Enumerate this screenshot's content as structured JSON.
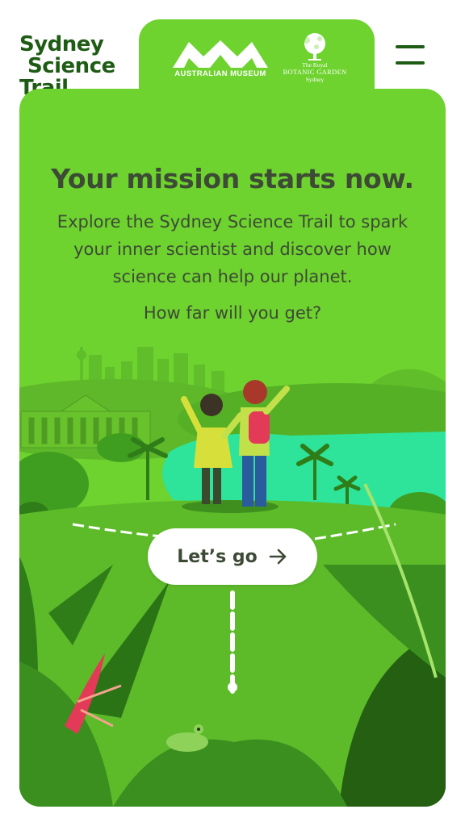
{
  "header": {
    "logo_lines": [
      "Sydney",
      "Science",
      "Trail"
    ],
    "partners": {
      "australian_museum": {
        "label": "AUSTRALIAN MUSEUM",
        "icon": "mountain-peaks-logo"
      },
      "royal_botanic_garden": {
        "line1": "The Royal",
        "line2": "BOTANIC GARDEN",
        "line3": "Sydney",
        "icon": "tree-logo"
      }
    },
    "menu_icon": "hamburger-menu-icon"
  },
  "hero": {
    "title": "Your mission starts now.",
    "description_lines": [
      "Explore the Sydney Science Trail to spark",
      "your inner scientist and discover how",
      "science can help our planet."
    ],
    "question": "How far will you get?"
  },
  "cta": {
    "label": "Let’s go",
    "icon": "arrow-right-icon"
  },
  "colors": {
    "brand_dark_green": "#1e5b14",
    "card_green": "#6ed22f",
    "text_dark": "#3d4a36",
    "water": "#2ee39a",
    "button_bg": "#ffffff"
  }
}
